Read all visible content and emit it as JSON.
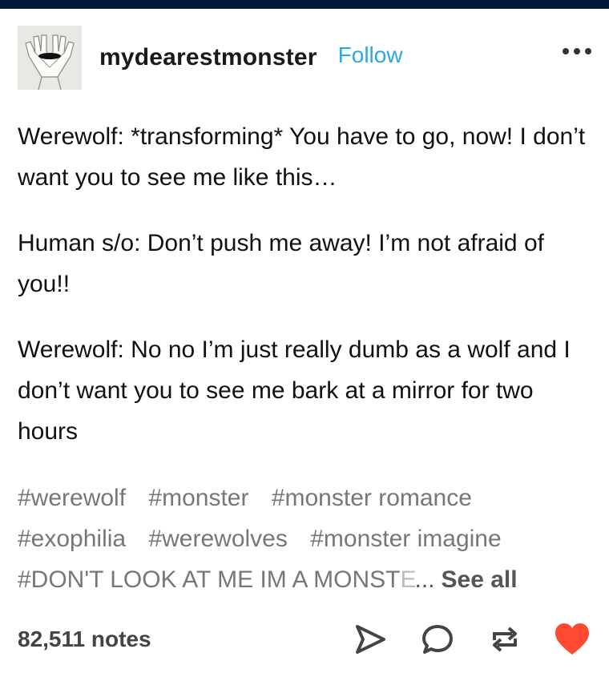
{
  "post": {
    "username": "mydearestmonster",
    "follow_label": "Follow",
    "avatar_icon": "avatar-hands-over-eyes-icon",
    "more_icon": "more-options-icon",
    "paragraphs": [
      "Werewolf: *transforming* You have to go, now! I don’t want you to see me like this…",
      "Human s/o: Don’t push me away! I’m not afraid of you!!",
      "Werewolf: No no I’m just really dumb as a wolf and I don’t want you to see me bark at a mirror for two hours"
    ],
    "tags": [
      "#werewolf",
      "#monster",
      "#monster romance",
      "#exophilia",
      "#werewolves",
      "#monster imagine"
    ],
    "truncated_tag_visible": "#DON'T LOOK AT ME IM A MONST",
    "truncated_tag_faded": "E",
    "ellipsis": "...",
    "see_all_label": "See all"
  },
  "footer": {
    "notes_label": "82,511 notes",
    "share_icon": "send-icon",
    "reply_icon": "reply-bubble-icon",
    "reblog_icon": "reblog-icon",
    "like_icon": "heart-icon",
    "like_color": "#ff4930",
    "icon_color": "#444444"
  },
  "colors": {
    "topbar": "#001935",
    "follow": "#2ba8e0",
    "tags": "#777777"
  }
}
